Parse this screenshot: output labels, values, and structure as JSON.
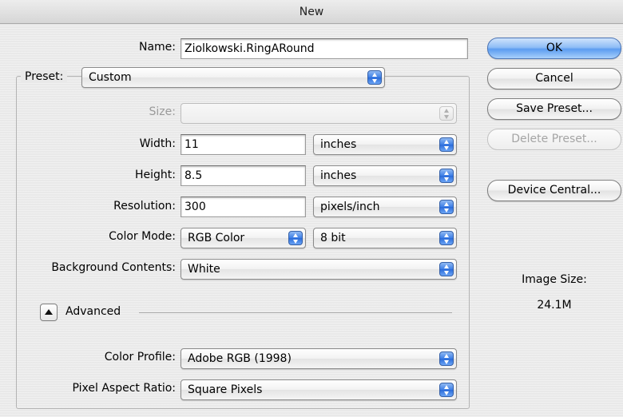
{
  "window": {
    "title": "New"
  },
  "name": {
    "label": "Name:",
    "value": "Ziolkowski.RingARound"
  },
  "preset": {
    "label": "Preset:",
    "value": "Custom"
  },
  "size": {
    "label": "Size:",
    "value": ""
  },
  "width": {
    "label": "Width:",
    "value": "11",
    "unit": "inches"
  },
  "height": {
    "label": "Height:",
    "value": "8.5",
    "unit": "inches"
  },
  "resolution": {
    "label": "Resolution:",
    "value": "300",
    "unit": "pixels/inch"
  },
  "color_mode": {
    "label": "Color Mode:",
    "value": "RGB Color",
    "depth": "8 bit"
  },
  "background": {
    "label": "Background Contents:",
    "value": "White"
  },
  "advanced": {
    "label": "Advanced",
    "expanded": true
  },
  "color_profile": {
    "label": "Color Profile:",
    "value": "Adobe RGB (1998)"
  },
  "pixel_aspect": {
    "label": "Pixel Aspect Ratio:",
    "value": "Square Pixels"
  },
  "buttons": {
    "ok": "OK",
    "cancel": "Cancel",
    "save_preset": "Save Preset...",
    "delete_preset": "Delete Preset...",
    "device_central": "Device Central..."
  },
  "image_size": {
    "label": "Image Size:",
    "value": "24.1M"
  },
  "colors": {
    "accent": "#3d7ee6",
    "default_button": "#8fbdf6"
  }
}
